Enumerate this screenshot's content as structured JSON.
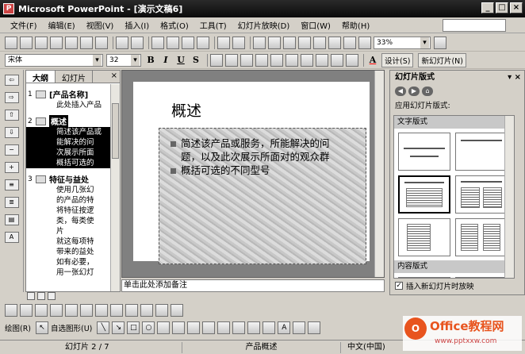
{
  "window": {
    "title": "Microsoft PowerPoint - [演示文稿6]"
  },
  "menubar": {
    "items": [
      "文件(F)",
      "编辑(E)",
      "视图(V)",
      "插入(I)",
      "格式(O)",
      "工具(T)",
      "幻灯片放映(D)",
      "窗口(W)",
      "帮助(H)"
    ]
  },
  "toolbar_standard": {
    "zoom": "33%"
  },
  "toolbar_format": {
    "font": "宋体",
    "size": "32",
    "design_label": "设计(S)",
    "new_slide_label": "新幻灯片(N)"
  },
  "outline_pane": {
    "tabs": [
      "大纲",
      "幻灯片"
    ],
    "slides": [
      {
        "num": "1",
        "title": "[产品名称]",
        "lines": [
          "此处插入产品"
        ]
      },
      {
        "num": "2",
        "title": "概述",
        "bullets": [
          "简述该产品或",
          "能解决的问",
          "次展示所面",
          "概括可选的"
        ]
      },
      {
        "num": "3",
        "title": "特征与益处",
        "bullets": [
          "使用几张幻",
          "的产品的特",
          "将特征按逻",
          "类，每类使",
          "片",
          "就这每项特",
          "带来的益处",
          "如有必要，",
          "用一张幻灯"
        ]
      }
    ]
  },
  "slide": {
    "title": "概述",
    "bullets": [
      "简述该产品或服务，所能解决的问题，以及此次展示所面对的观众群",
      "概括可选的不同型号"
    ],
    "bullet_lines": [
      "简述该产品或服务，所能解决的问",
      "题，以及此次展示所面对的观众群",
      "概括可选的不同型号"
    ]
  },
  "notes": {
    "placeholder": "单击此处添加备注"
  },
  "task_pane": {
    "title": "幻灯片版式",
    "apply_label": "应用幻灯片版式:",
    "section_text": "文字版式",
    "section_content": "内容版式",
    "checkbox_label": "插入新幻灯片时放映",
    "checked": true
  },
  "drawing_toolbar": {
    "draw_label": "绘图(R)",
    "autoshape_label": "自选图形(U)"
  },
  "statusbar": {
    "slide_position": "幻灯片 2 / 7",
    "design_name": "产品概述",
    "language": "中文(中国)"
  },
  "watermark": {
    "logo": "O",
    "brand": "Office教程网",
    "url": "www.pptxxw.com"
  }
}
